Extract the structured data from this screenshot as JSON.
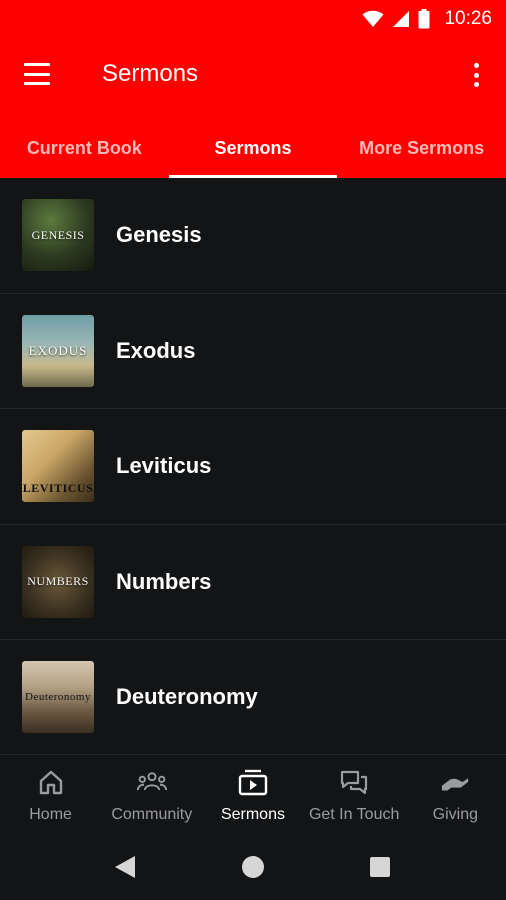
{
  "status_bar": {
    "time": "10:26",
    "icons": [
      "wifi-icon",
      "signal-icon",
      "battery-icon"
    ]
  },
  "app_bar": {
    "title": "Sermons",
    "menu_icon": "hamburger-menu-icon",
    "overflow_icon": "more-vert-icon"
  },
  "tabs": [
    {
      "label": "Current Book",
      "active": false
    },
    {
      "label": "Sermons",
      "active": true
    },
    {
      "label": "More Sermons",
      "active": false
    }
  ],
  "list": {
    "items": [
      {
        "label": "Genesis",
        "thumb_text": "GENESIS"
      },
      {
        "label": "Exodus",
        "thumb_text": "EXODUS"
      },
      {
        "label": "Leviticus",
        "thumb_text": "LEVITICUS"
      },
      {
        "label": "Numbers",
        "thumb_text": "NUMBERS"
      },
      {
        "label": "Deuteronomy",
        "thumb_text": "Deuteronomy"
      }
    ]
  },
  "bottom_nav": {
    "items": [
      {
        "label": "Home",
        "icon": "home-icon",
        "active": false
      },
      {
        "label": "Community",
        "icon": "people-icon",
        "active": false
      },
      {
        "label": "Sermons",
        "icon": "video-library-icon",
        "active": true
      },
      {
        "label": "Get In Touch",
        "icon": "chat-bubbles-icon",
        "active": false
      },
      {
        "label": "Giving",
        "icon": "giving-hand-icon",
        "active": false
      }
    ]
  },
  "colors": {
    "accent": "#ff0000",
    "background": "#131416",
    "inactive_nav": "#9a9b9e"
  }
}
